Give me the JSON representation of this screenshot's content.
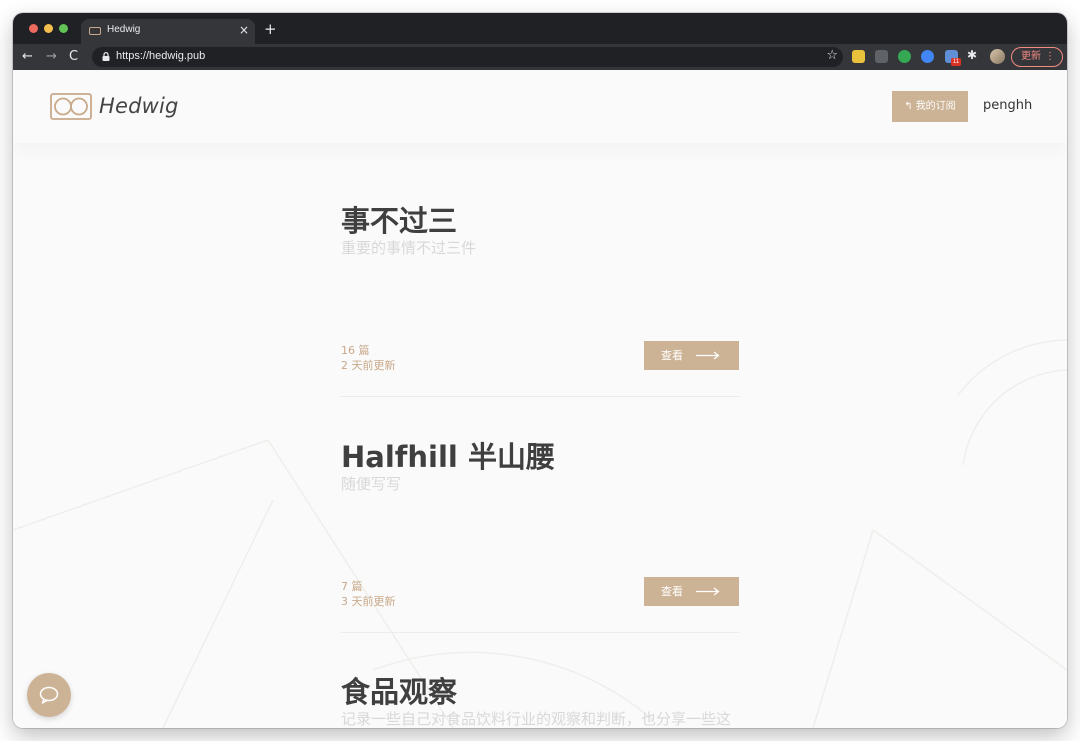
{
  "browser": {
    "tab_title": "Hedwig",
    "tab_close": "×",
    "new_tab": "+",
    "url": "https://hedwig.pub",
    "back": "←",
    "forward": "→",
    "reload": "C",
    "bookmark": "☆",
    "extension_badge": "11",
    "extension_puzzle": "✱",
    "update_label": "更新",
    "menu_dots": "⋮"
  },
  "header": {
    "logo_text": "Hedwig",
    "subscriptions_arrow": "↰",
    "subscriptions_label": "我的订阅",
    "username": "penghh"
  },
  "publications": [
    {
      "title": "事不过三",
      "description": "重要的事情不过三件",
      "count": "16 篇",
      "updated": "2 天前更新",
      "view_label": "查看"
    },
    {
      "title": "Halfhill 半山腰",
      "description": "随便写写",
      "count": "7 篇",
      "updated": "3 天前更新",
      "view_label": "查看"
    },
    {
      "title": "食品观察",
      "description": "记录一些自己对食品饮料行业的观察和判断，也分享一些这个领域优质的内容",
      "count": "",
      "updated": "",
      "view_label": ""
    }
  ],
  "colors": {
    "accent": "#cdb396",
    "accent_text": "#c9a98a",
    "title_text": "#3f3f3f",
    "desc_text": "#d8d8d8"
  },
  "icons": {
    "chat": "chat-bubble-icon",
    "lock": "lock-icon",
    "arrow": "long-arrow-right-icon"
  }
}
